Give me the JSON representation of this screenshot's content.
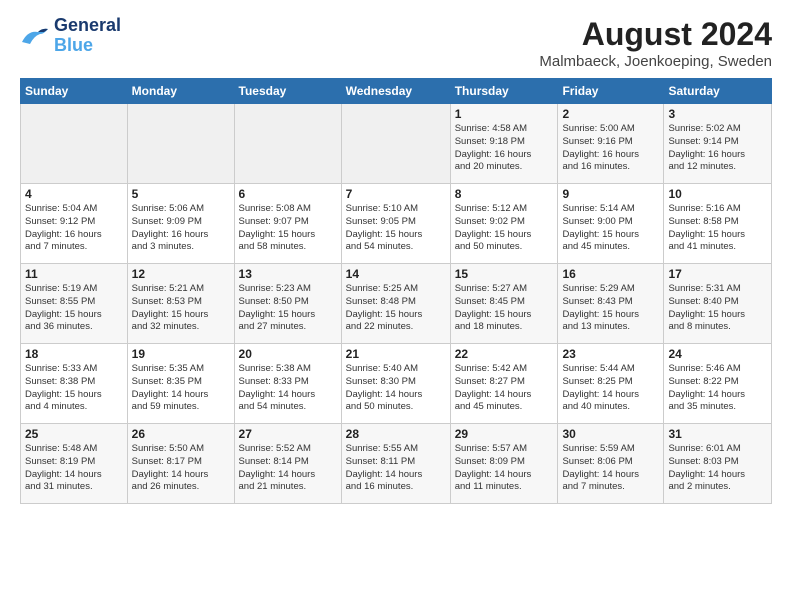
{
  "header": {
    "logo_line1": "General",
    "logo_line2": "Blue",
    "title": "August 2024",
    "subtitle": "Malmbaeck, Joenkoeping, Sweden"
  },
  "days_of_week": [
    "Sunday",
    "Monday",
    "Tuesday",
    "Wednesday",
    "Thursday",
    "Friday",
    "Saturday"
  ],
  "weeks": [
    [
      {
        "day": "",
        "info": ""
      },
      {
        "day": "",
        "info": ""
      },
      {
        "day": "",
        "info": ""
      },
      {
        "day": "",
        "info": ""
      },
      {
        "day": "1",
        "info": "Sunrise: 4:58 AM\nSunset: 9:18 PM\nDaylight: 16 hours\nand 20 minutes."
      },
      {
        "day": "2",
        "info": "Sunrise: 5:00 AM\nSunset: 9:16 PM\nDaylight: 16 hours\nand 16 minutes."
      },
      {
        "day": "3",
        "info": "Sunrise: 5:02 AM\nSunset: 9:14 PM\nDaylight: 16 hours\nand 12 minutes."
      }
    ],
    [
      {
        "day": "4",
        "info": "Sunrise: 5:04 AM\nSunset: 9:12 PM\nDaylight: 16 hours\nand 7 minutes."
      },
      {
        "day": "5",
        "info": "Sunrise: 5:06 AM\nSunset: 9:09 PM\nDaylight: 16 hours\nand 3 minutes."
      },
      {
        "day": "6",
        "info": "Sunrise: 5:08 AM\nSunset: 9:07 PM\nDaylight: 15 hours\nand 58 minutes."
      },
      {
        "day": "7",
        "info": "Sunrise: 5:10 AM\nSunset: 9:05 PM\nDaylight: 15 hours\nand 54 minutes."
      },
      {
        "day": "8",
        "info": "Sunrise: 5:12 AM\nSunset: 9:02 PM\nDaylight: 15 hours\nand 50 minutes."
      },
      {
        "day": "9",
        "info": "Sunrise: 5:14 AM\nSunset: 9:00 PM\nDaylight: 15 hours\nand 45 minutes."
      },
      {
        "day": "10",
        "info": "Sunrise: 5:16 AM\nSunset: 8:58 PM\nDaylight: 15 hours\nand 41 minutes."
      }
    ],
    [
      {
        "day": "11",
        "info": "Sunrise: 5:19 AM\nSunset: 8:55 PM\nDaylight: 15 hours\nand 36 minutes."
      },
      {
        "day": "12",
        "info": "Sunrise: 5:21 AM\nSunset: 8:53 PM\nDaylight: 15 hours\nand 32 minutes."
      },
      {
        "day": "13",
        "info": "Sunrise: 5:23 AM\nSunset: 8:50 PM\nDaylight: 15 hours\nand 27 minutes."
      },
      {
        "day": "14",
        "info": "Sunrise: 5:25 AM\nSunset: 8:48 PM\nDaylight: 15 hours\nand 22 minutes."
      },
      {
        "day": "15",
        "info": "Sunrise: 5:27 AM\nSunset: 8:45 PM\nDaylight: 15 hours\nand 18 minutes."
      },
      {
        "day": "16",
        "info": "Sunrise: 5:29 AM\nSunset: 8:43 PM\nDaylight: 15 hours\nand 13 minutes."
      },
      {
        "day": "17",
        "info": "Sunrise: 5:31 AM\nSunset: 8:40 PM\nDaylight: 15 hours\nand 8 minutes."
      }
    ],
    [
      {
        "day": "18",
        "info": "Sunrise: 5:33 AM\nSunset: 8:38 PM\nDaylight: 15 hours\nand 4 minutes."
      },
      {
        "day": "19",
        "info": "Sunrise: 5:35 AM\nSunset: 8:35 PM\nDaylight: 14 hours\nand 59 minutes."
      },
      {
        "day": "20",
        "info": "Sunrise: 5:38 AM\nSunset: 8:33 PM\nDaylight: 14 hours\nand 54 minutes."
      },
      {
        "day": "21",
        "info": "Sunrise: 5:40 AM\nSunset: 8:30 PM\nDaylight: 14 hours\nand 50 minutes."
      },
      {
        "day": "22",
        "info": "Sunrise: 5:42 AM\nSunset: 8:27 PM\nDaylight: 14 hours\nand 45 minutes."
      },
      {
        "day": "23",
        "info": "Sunrise: 5:44 AM\nSunset: 8:25 PM\nDaylight: 14 hours\nand 40 minutes."
      },
      {
        "day": "24",
        "info": "Sunrise: 5:46 AM\nSunset: 8:22 PM\nDaylight: 14 hours\nand 35 minutes."
      }
    ],
    [
      {
        "day": "25",
        "info": "Sunrise: 5:48 AM\nSunset: 8:19 PM\nDaylight: 14 hours\nand 31 minutes."
      },
      {
        "day": "26",
        "info": "Sunrise: 5:50 AM\nSunset: 8:17 PM\nDaylight: 14 hours\nand 26 minutes."
      },
      {
        "day": "27",
        "info": "Sunrise: 5:52 AM\nSunset: 8:14 PM\nDaylight: 14 hours\nand 21 minutes."
      },
      {
        "day": "28",
        "info": "Sunrise: 5:55 AM\nSunset: 8:11 PM\nDaylight: 14 hours\nand 16 minutes."
      },
      {
        "day": "29",
        "info": "Sunrise: 5:57 AM\nSunset: 8:09 PM\nDaylight: 14 hours\nand 11 minutes."
      },
      {
        "day": "30",
        "info": "Sunrise: 5:59 AM\nSunset: 8:06 PM\nDaylight: 14 hours\nand 7 minutes."
      },
      {
        "day": "31",
        "info": "Sunrise: 6:01 AM\nSunset: 8:03 PM\nDaylight: 14 hours\nand 2 minutes."
      }
    ]
  ]
}
